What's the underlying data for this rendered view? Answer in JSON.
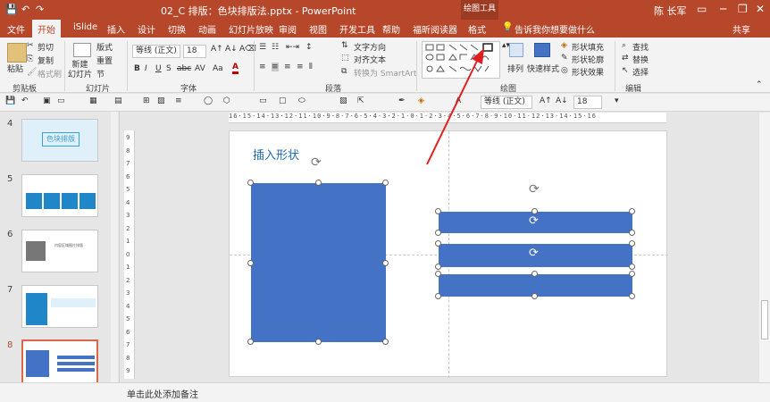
{
  "window": {
    "title": "02_C 排版：色块排版法.pptx - PowerPoint",
    "context_header": "绘图工具",
    "user": "陈 长军"
  },
  "tabs": [
    "文件",
    "开始",
    "iSlide",
    "插入",
    "设计",
    "切换",
    "动画",
    "幻灯片放映",
    "审阅",
    "视图",
    "开发工具",
    "帮助",
    "福昕阅读器",
    "格式"
  ],
  "active_tab": "开始",
  "tell_me": "告诉我你想要做什么",
  "share": "共享",
  "ribbon": {
    "clipboard": {
      "paste": "粘贴",
      "cut": "剪切",
      "copy": "复制",
      "painter": "格式刷",
      "group": "剪贴板"
    },
    "slides": {
      "new": "新建\n幻灯片",
      "layout": "版式",
      "reset": "重置",
      "section": "节",
      "group": "幻灯片"
    },
    "font": {
      "name": "等线 (正文)",
      "size": "18",
      "group": "字体",
      "bold": "B",
      "italic": "I",
      "underline": "U",
      "strike": "S",
      "shadow": "abc",
      "spacing": "AV",
      "case": "Aa"
    },
    "paragraph": {
      "direction": "文字方向",
      "align": "对齐文本",
      "smartart": "转换为 SmartArt",
      "group": "段落"
    },
    "drawing": {
      "arrange": "排列",
      "quick_styles": "快速样式",
      "fill": "形状填充",
      "outline": "形状轮廓",
      "effects": "形状效果",
      "group": "绘图"
    },
    "editing": {
      "find": "查找",
      "replace": "替换",
      "select": "选择",
      "group": "编辑"
    }
  },
  "qbar": {
    "font": "等线 (正文)",
    "size": "18"
  },
  "thumbnails": [
    {
      "num": "4",
      "text": "色块排版"
    },
    {
      "num": "5"
    },
    {
      "num": "6",
      "text": "内容区域图片排版"
    },
    {
      "num": "7"
    },
    {
      "num": "8",
      "active": true
    }
  ],
  "hruler": "16·15·14·13·12·11·10·9·8·7·6·5·4·3·2·1·0·1·2·3·4·5·6·7·8·9·10·11·12·13·14·15·16",
  "vruler": [
    "9",
    "8",
    "7",
    "6",
    "5",
    "4",
    "3",
    "2",
    "1",
    "0",
    "1",
    "2",
    "3",
    "4",
    "5",
    "6",
    "7",
    "8",
    "9"
  ],
  "slide": {
    "title": "插入形状",
    "shape_color": "#4472c4"
  },
  "status": {
    "notes": "单击此处添加备注"
  }
}
